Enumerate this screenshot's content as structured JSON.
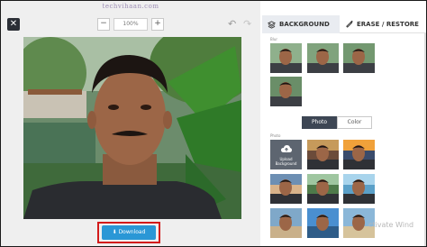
{
  "watermark": "techvihaan.com",
  "editor": {
    "close_glyph": "✕",
    "zoom_out": "−",
    "zoom_value": "100%",
    "zoom_in": "+",
    "undo_glyph": "↶",
    "redo_glyph": "↷",
    "download_label": "Download",
    "download_icon": "⬇"
  },
  "panel": {
    "tab_background": "BACKGROUND",
    "tab_erase": "ERASE / RESTORE",
    "blur_label": "Blur",
    "toggle": {
      "photo": "Photo",
      "color": "Color",
      "selected": "Photo"
    },
    "photo_label": "Photo",
    "upload_label_1": "Upload",
    "upload_label_2": "Background"
  },
  "overlay_text": "ctivate Wind",
  "colors": {
    "download_blue": "#2a97d6",
    "highlight_red": "#d31a1a",
    "toggle_dark": "#3d4654",
    "tab_active_bg": "#e9ecf1"
  },
  "icons": {
    "tab_background": "layers-icon",
    "tab_erase": "brush-icon",
    "upload": "cloud-upload-icon"
  }
}
